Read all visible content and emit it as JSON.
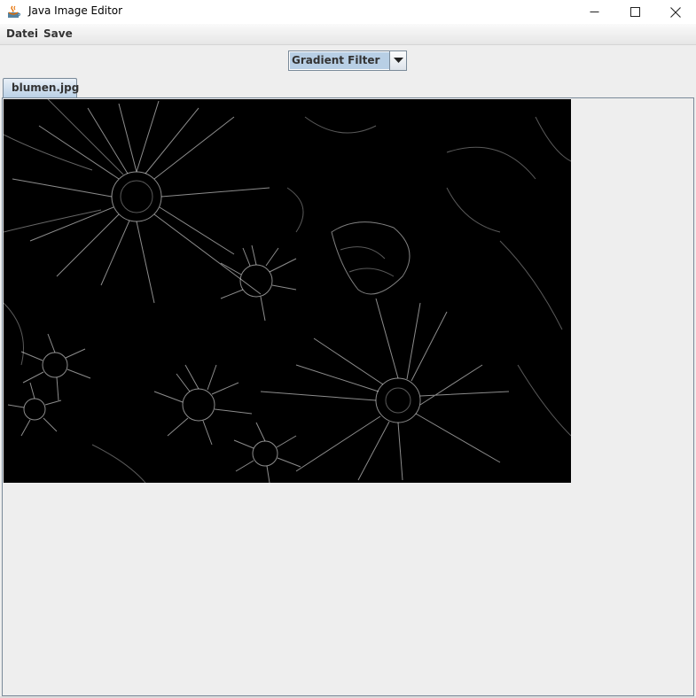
{
  "window": {
    "title": "Java Image Editor",
    "app_icon": "java-cup-icon",
    "controls": [
      "minimize-icon",
      "maximize-icon",
      "close-icon"
    ]
  },
  "menu": {
    "items": [
      {
        "label": "Datei"
      },
      {
        "label": "Save"
      }
    ]
  },
  "filter_select": {
    "selected": "Gradient Filter",
    "arrow_icon": "chevron-down-icon"
  },
  "tabs": [
    {
      "label": "blumen.jpg",
      "active": true
    }
  ],
  "image": {
    "description_icon": "image-canvas",
    "background": "#000000",
    "line_color": "#ffffff"
  },
  "colors": {
    "selection": "#b8cfe5",
    "border": "#7a8a99",
    "panel": "#eeeeee"
  }
}
